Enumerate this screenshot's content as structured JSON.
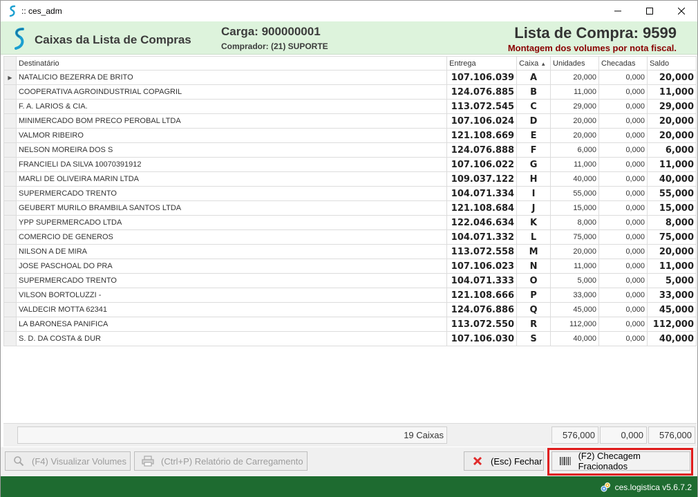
{
  "window": {
    "title": ":: ces_adm"
  },
  "header": {
    "title": "Caixas da Lista de Compras",
    "carga": "Carga: 900000001",
    "comprador": "Comprador: (21) SUPORTE",
    "lista": "Lista de Compra: 9599",
    "montagem": "Montagem dos volumes por nota fiscal."
  },
  "grid": {
    "columns": [
      "Destinatário",
      "Entrega",
      "Caixa",
      "Unidades",
      "Checadas",
      "Saldo"
    ],
    "rows": [
      {
        "dest": "NATALICIO BEZERRA DE BRITO",
        "entrega": "107.106.039",
        "caixa": "A",
        "unidades": "20,000",
        "checadas": "0,000",
        "saldo": "20,000"
      },
      {
        "dest": "COOPERATIVA AGROINDUSTRIAL COPAGRIL",
        "entrega": "124.076.885",
        "caixa": "B",
        "unidades": "11,000",
        "checadas": "0,000",
        "saldo": "11,000"
      },
      {
        "dest": "F. A. LARIOS & CIA.",
        "entrega": "113.072.545",
        "caixa": "C",
        "unidades": "29,000",
        "checadas": "0,000",
        "saldo": "29,000"
      },
      {
        "dest": "MINIMERCADO BOM PRECO PEROBAL LTDA",
        "entrega": "107.106.024",
        "caixa": "D",
        "unidades": "20,000",
        "checadas": "0,000",
        "saldo": "20,000"
      },
      {
        "dest": "VALMOR RIBEIRO",
        "entrega": "121.108.669",
        "caixa": "E",
        "unidades": "20,000",
        "checadas": "0,000",
        "saldo": "20,000"
      },
      {
        "dest": "NELSON MOREIRA DOS S",
        "entrega": "124.076.888",
        "caixa": "F",
        "unidades": "6,000",
        "checadas": "0,000",
        "saldo": "6,000"
      },
      {
        "dest": "FRANCIELI DA SILVA 10070391912",
        "entrega": "107.106.022",
        "caixa": "G",
        "unidades": "11,000",
        "checadas": "0,000",
        "saldo": "11,000"
      },
      {
        "dest": "MARLI DE OLIVEIRA MARIN LTDA",
        "entrega": "109.037.122",
        "caixa": "H",
        "unidades": "40,000",
        "checadas": "0,000",
        "saldo": "40,000"
      },
      {
        "dest": "SUPERMERCADO TRENTO",
        "entrega": "104.071.334",
        "caixa": "I",
        "unidades": "55,000",
        "checadas": "0,000",
        "saldo": "55,000"
      },
      {
        "dest": "GEUBERT MURILO BRAMBILA SANTOS LTDA",
        "entrega": "121.108.684",
        "caixa": "J",
        "unidades": "15,000",
        "checadas": "0,000",
        "saldo": "15,000"
      },
      {
        "dest": "YPP SUPERMERCADO LTDA",
        "entrega": "122.046.634",
        "caixa": "K",
        "unidades": "8,000",
        "checadas": "0,000",
        "saldo": "8,000"
      },
      {
        "dest": "COMERCIO DE GENEROS",
        "entrega": "104.071.332",
        "caixa": "L",
        "unidades": "75,000",
        "checadas": "0,000",
        "saldo": "75,000"
      },
      {
        "dest": "NILSON A DE MIRA",
        "entrega": "113.072.558",
        "caixa": "M",
        "unidades": "20,000",
        "checadas": "0,000",
        "saldo": "20,000"
      },
      {
        "dest": "JOSE PASCHOAL DO PRA",
        "entrega": "107.106.023",
        "caixa": "N",
        "unidades": "11,000",
        "checadas": "0,000",
        "saldo": "11,000"
      },
      {
        "dest": "SUPERMERCADO TRENTO",
        "entrega": "104.071.333",
        "caixa": "O",
        "unidades": "5,000",
        "checadas": "0,000",
        "saldo": "5,000"
      },
      {
        "dest": "VILSON BORTOLUZZI -",
        "entrega": "121.108.666",
        "caixa": "P",
        "unidades": "33,000",
        "checadas": "0,000",
        "saldo": "33,000"
      },
      {
        "dest": "VALDECIR MOTTA 62341",
        "entrega": "124.076.886",
        "caixa": "Q",
        "unidades": "45,000",
        "checadas": "0,000",
        "saldo": "45,000"
      },
      {
        "dest": "LA BARONESA PANIFICA",
        "entrega": "113.072.550",
        "caixa": "R",
        "unidades": "112,000",
        "checadas": "0,000",
        "saldo": "112,000"
      },
      {
        "dest": "S. D. DA COSTA & DUR",
        "entrega": "107.106.030",
        "caixa": "S",
        "unidades": "40,000",
        "checadas": "0,000",
        "saldo": "40,000"
      }
    ],
    "sort_column": "Caixa",
    "sort_direction": "ascending"
  },
  "totals": {
    "count_label": "19 Caixas",
    "unidades": "576,000",
    "checadas": "0,000",
    "saldo": "576,000"
  },
  "buttons": {
    "visualizar": "(F4) Visualizar Volumes",
    "relatorio": "(Ctrl+P) Relatório de Carregamento",
    "fechar": "(Esc) Fechar",
    "checagem": "(F2) Checagem Fracionados"
  },
  "status": {
    "version": "ces.logistica v5.6.7.2"
  },
  "colors": {
    "header_bg": "#ddf3dc",
    "status_bg": "#1e6b30",
    "accent_red": "#8a0000",
    "highlight": "#e01b1b"
  }
}
